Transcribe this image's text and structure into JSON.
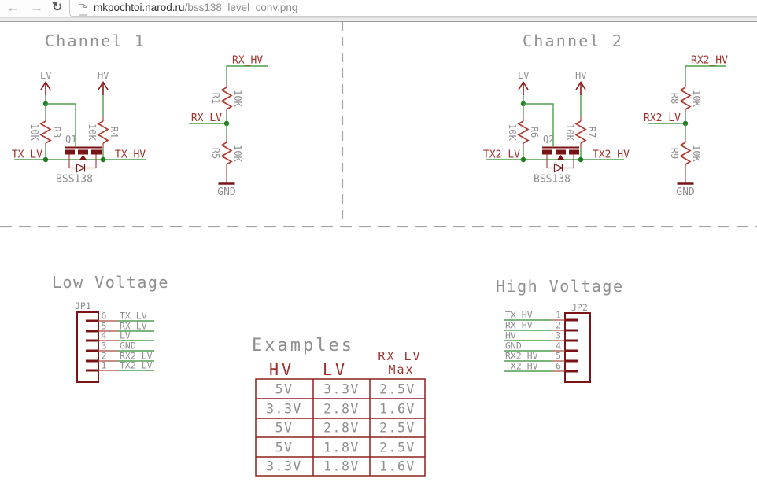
{
  "browser": {
    "back_icon": "←",
    "forward_icon": "→",
    "reload_icon": "↻",
    "url_host": "mkpochtoi.narod.ru",
    "url_path": "/bss138_level_conv.png"
  },
  "colors": {
    "wire_green": "#4f9d4f",
    "symbol_red": "#7a1315",
    "label_red": "#9e322c",
    "text_grey": "#8f8f8f"
  },
  "channel1": {
    "title": "Channel 1",
    "lv": "LV",
    "hv": "HV",
    "net_left": "TX_LV",
    "net_right": "TX_HV",
    "q_name": "Q1",
    "q_value": "BSS138",
    "r_left_value": "10K",
    "r_left_name": "R3",
    "r_right_value": "10K",
    "r_right_name": "R4",
    "div_net_top": "RX_HV",
    "div_net_mid": "RX_LV",
    "div_r_top_name": "R1",
    "div_r_top_value": "10K",
    "div_r_bot_name": "R5",
    "div_r_bot_value": "10K",
    "gnd": "GND"
  },
  "channel2": {
    "title": "Channel 2",
    "lv": "LV",
    "hv": "HV",
    "net_left": "TX2_LV",
    "net_right": "TX2_HV",
    "q_name": "Q2",
    "q_value": "BSS138",
    "r_left_value": "10K",
    "r_left_name": "R6",
    "r_right_value": "10K",
    "r_right_name": "R7",
    "div_net_top": "RX2_HV",
    "div_net_mid": "RX2_LV",
    "div_r_top_name": "R8",
    "div_r_top_value": "10K",
    "div_r_bot_name": "R9",
    "div_r_bot_value": "10K",
    "gnd": "GND"
  },
  "low_voltage": {
    "title": "Low Voltage",
    "refdes": "JP1",
    "pins": [
      {
        "num": "6",
        "net": "TX_LV"
      },
      {
        "num": "5",
        "net": "RX_LV"
      },
      {
        "num": "4",
        "net": "LV"
      },
      {
        "num": "3",
        "net": "GND"
      },
      {
        "num": "2",
        "net": "RX2_LV"
      },
      {
        "num": "1",
        "net": "TX2_LV"
      }
    ]
  },
  "high_voltage": {
    "title": "High Voltage",
    "refdes": "JP2",
    "pins": [
      {
        "num": "1",
        "net": "TX_HV"
      },
      {
        "num": "2",
        "net": "RX_HV"
      },
      {
        "num": "3",
        "net": "HV"
      },
      {
        "num": "4",
        "net": "GND"
      },
      {
        "num": "5",
        "net": "RX2_HV"
      },
      {
        "num": "6",
        "net": "TX2_HV"
      }
    ]
  },
  "examples": {
    "title": "Examples",
    "chart_data": {
      "type": "table",
      "columns": [
        "HV",
        "LV",
        "RX_LV Max"
      ],
      "header_rx_line1": "RX_LV",
      "header_rx_line2": "Max",
      "rows": [
        [
          "5V",
          "3.3V",
          "2.5V"
        ],
        [
          "3.3V",
          "2.8V",
          "1.6V"
        ],
        [
          "5V",
          "2.8V",
          "2.5V"
        ],
        [
          "5V",
          "1.8V",
          "2.5V"
        ],
        [
          "3.3V",
          "1.8V",
          "1.6V"
        ]
      ]
    }
  }
}
